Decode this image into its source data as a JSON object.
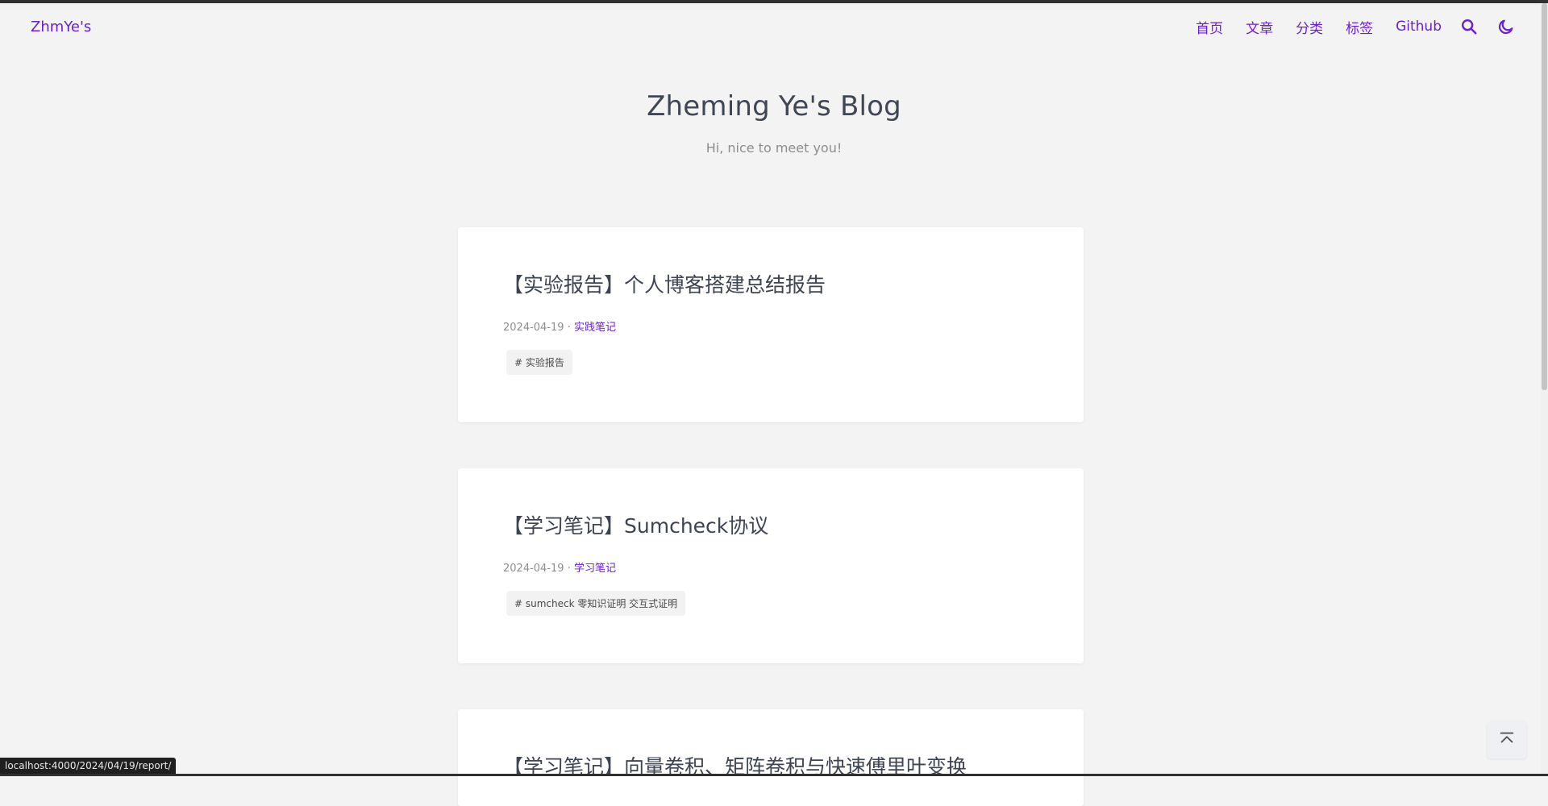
{
  "nav": {
    "brand": "ZhmYe's",
    "items": [
      "首页",
      "文章",
      "分类",
      "标签",
      "Github"
    ],
    "icons": {
      "search": "search-icon",
      "theme": "moon-icon"
    },
    "accent": "#6b1fd1"
  },
  "header": {
    "title": "Zheming Ye's Blog",
    "subtitle": "Hi, nice to meet you!"
  },
  "posts": [
    {
      "title": "【实验报告】个人博客搭建总结报告",
      "date": "2024-04-19",
      "sep": " · ",
      "category": "实践笔记",
      "tags": "# 实验报告"
    },
    {
      "title": "【学习笔记】Sumcheck协议",
      "date": "2024-04-19",
      "sep": " · ",
      "category": "学习笔记",
      "tags": "# sumcheck 零知识证明 交互式证明"
    },
    {
      "title": "【学习笔记】向量卷积、矩阵卷积与快速傅里叶变换",
      "date": "",
      "sep": "",
      "category": "",
      "tags": ""
    }
  ],
  "status_url": "localhost:4000/2024/04/19/report/",
  "back_to_top_icon": "arrow-up-bar-icon"
}
